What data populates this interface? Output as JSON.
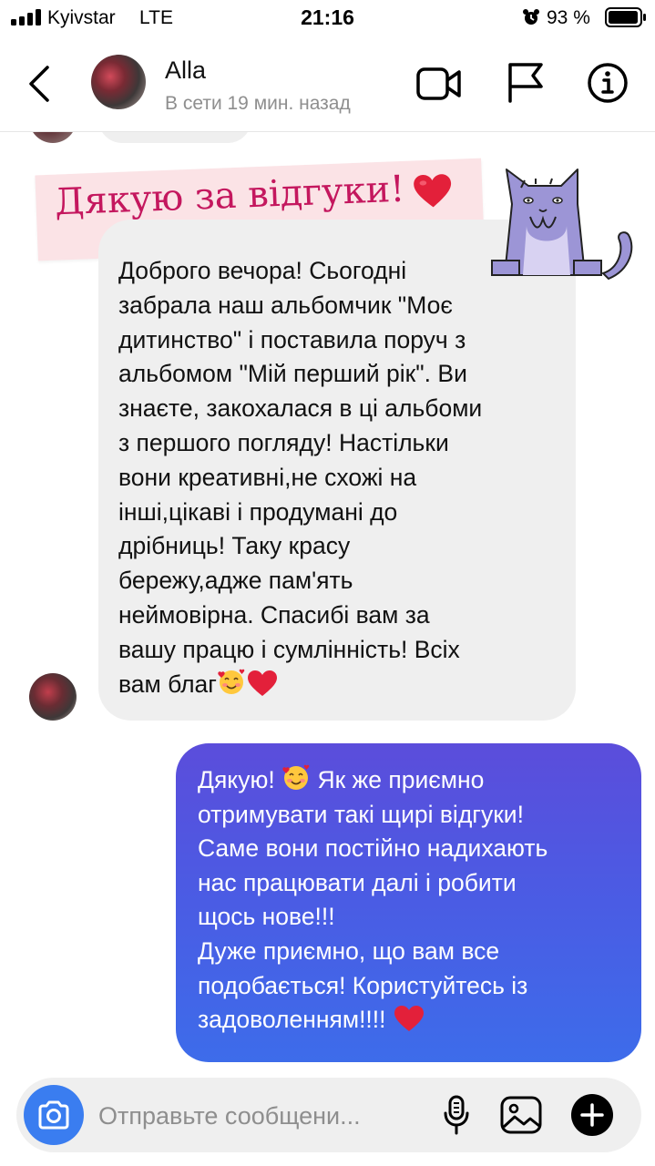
{
  "status_bar": {
    "carrier": "Kyivstar",
    "network": "LTE",
    "time": "21:16",
    "battery": "93 %"
  },
  "header": {
    "contact_name": "Alla",
    "contact_status": "В сети 19 мин. назад"
  },
  "sticker": {
    "text": "Дякую за відгуки!"
  },
  "messages": {
    "incoming": {
      "lines": [
        "Доброго вечора! Сьогодні",
        "забрала наш альбомчик \"Моє",
        "дитинство\" і поставила поруч з",
        "альбомом \"Мій перший рік\". Ви",
        "знаєте, закохалася в ці альбоми",
        "з першого погляду! Настільки",
        "вони креативні,не схожі на",
        "інші,цікаві і продумані до",
        "дрібниць! Таку красу",
        "бережу,адже пам'ять",
        "неймовірна. Спасибі вам за",
        "вашу працю і сумлінність! Всіх",
        "вам благ"
      ]
    },
    "outgoing": {
      "line1_a": "Дякую!",
      "line1_b": "Як же приємно",
      "lines": [
        "отримувати такі щирі відгуки!",
        "Саме вони постійно надихають",
        "нас працювати далі і робити",
        "щось нове!!!",
        "Дуже приємно, що вам все",
        "подобається! Користуйтесь із"
      ],
      "last_line": "задоволенням!!!!"
    }
  },
  "composer": {
    "placeholder": "Отправьте сообщени..."
  },
  "colors": {
    "outgoing_bubble_top": "#5b4ddb",
    "outgoing_bubble_bottom": "#3d6cea",
    "incoming_bubble": "#efefef",
    "sticker_text": "#c4175e",
    "camera_button": "#3a7df0",
    "heart": "#e3203a"
  },
  "icons": {
    "back": "chevron-left-icon",
    "video": "video-camera-icon",
    "flag": "flag-icon",
    "info": "info-icon",
    "camera": "camera-icon",
    "mic": "microphone-icon",
    "gallery": "image-icon",
    "plus": "plus-icon"
  }
}
